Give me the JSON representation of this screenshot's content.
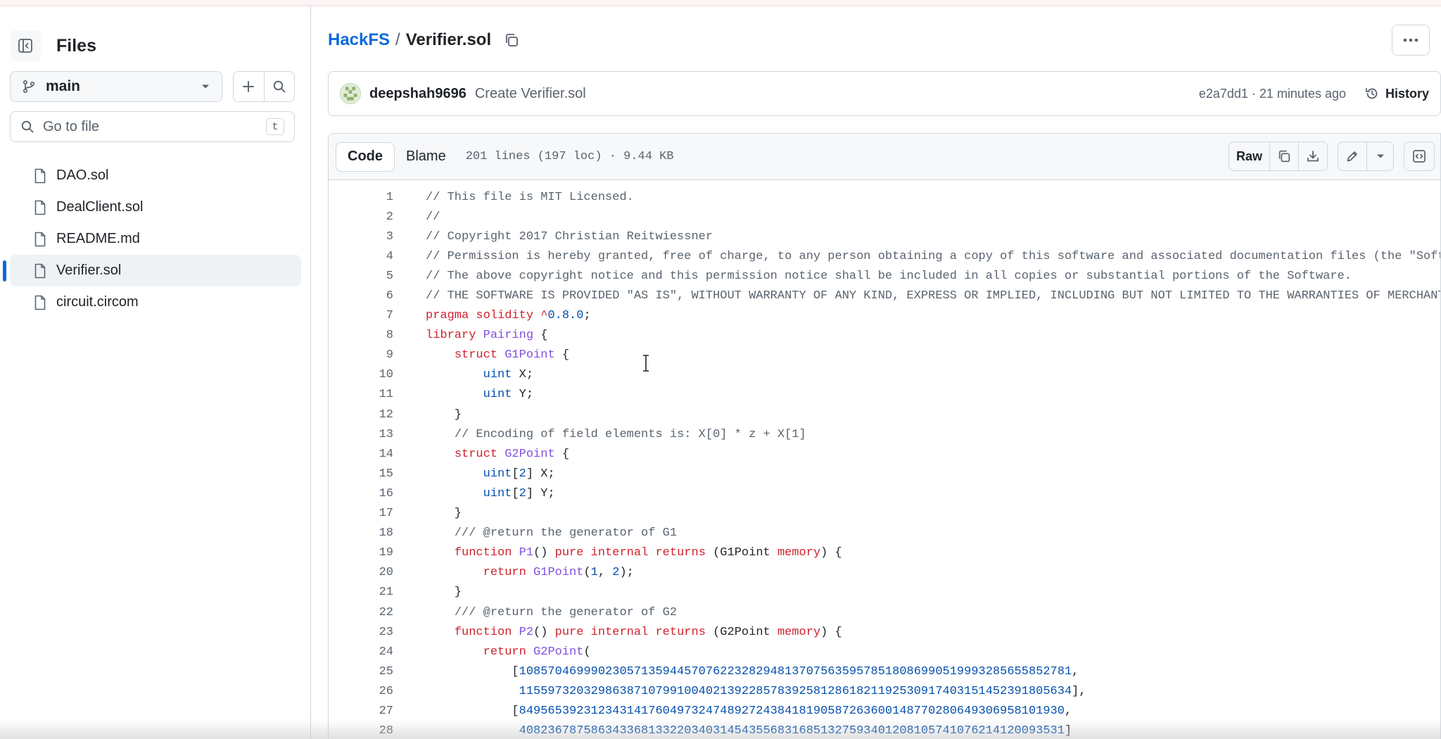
{
  "sidebar": {
    "title": "Files",
    "branch": "main",
    "goto_placeholder": "Go to file",
    "goto_shortcut": "t",
    "files": [
      {
        "name": "DAO.sol",
        "active": false
      },
      {
        "name": "DealClient.sol",
        "active": false
      },
      {
        "name": "README.md",
        "active": false
      },
      {
        "name": "Verifier.sol",
        "active": true
      },
      {
        "name": "circuit.circom",
        "active": false
      }
    ]
  },
  "breadcrumb": {
    "repo": "HackFS",
    "separator": "/",
    "file": "Verifier.sol"
  },
  "commit": {
    "author": "deepshah9696",
    "message": "Create Verifier.sol",
    "meta": "e2a7dd1 · 21 minutes ago",
    "history_label": "History"
  },
  "file_header": {
    "tab_code": "Code",
    "tab_blame": "Blame",
    "info": "201 lines (197 loc) · 9.44 KB",
    "raw_label": "Raw"
  },
  "colors": {
    "accent": "#0969da",
    "comment": "#59636e",
    "keyword": "#cf222e",
    "type": "#0550ae",
    "entity": "#8250df"
  },
  "code_lines": [
    {
      "n": "1",
      "tokens": [
        [
          "c",
          "// This file is MIT Licensed."
        ]
      ]
    },
    {
      "n": "2",
      "tokens": [
        [
          "c",
          "//"
        ]
      ]
    },
    {
      "n": "3",
      "tokens": [
        [
          "c",
          "// Copyright 2017 Christian Reitwiessner"
        ]
      ]
    },
    {
      "n": "4",
      "tokens": [
        [
          "c",
          "// Permission is hereby granted, free of charge, to any person obtaining a copy of this software and associated documentation files (the \"Soft"
        ]
      ]
    },
    {
      "n": "5",
      "tokens": [
        [
          "c",
          "// The above copyright notice and this permission notice shall be included in all copies or substantial portions of the Software."
        ]
      ]
    },
    {
      "n": "6",
      "tokens": [
        [
          "c",
          "// THE SOFTWARE IS PROVIDED \"AS IS\", WITHOUT WARRANTY OF ANY KIND, EXPRESS OR IMPLIED, INCLUDING BUT NOT LIMITED TO THE WARRANTIES OF MERCHANT"
        ]
      ]
    },
    {
      "n": "7",
      "tokens": [
        [
          "k",
          "pragma solidity "
        ],
        [
          "k",
          "^"
        ],
        [
          "t",
          "0.8.0"
        ],
        [
          "p",
          ";"
        ]
      ]
    },
    {
      "n": "8",
      "tokens": [
        [
          "k",
          "library "
        ],
        [
          "e",
          "Pairing"
        ],
        [
          "p",
          " {"
        ]
      ]
    },
    {
      "n": "9",
      "tokens": [
        [
          "p",
          "    "
        ],
        [
          "k",
          "struct "
        ],
        [
          "e",
          "G1Point"
        ],
        [
          "p",
          " {"
        ]
      ]
    },
    {
      "n": "10",
      "tokens": [
        [
          "p",
          "        "
        ],
        [
          "t",
          "uint"
        ],
        [
          "p",
          " X;"
        ]
      ]
    },
    {
      "n": "11",
      "tokens": [
        [
          "p",
          "        "
        ],
        [
          "t",
          "uint"
        ],
        [
          "p",
          " Y;"
        ]
      ]
    },
    {
      "n": "12",
      "tokens": [
        [
          "p",
          "    }"
        ]
      ]
    },
    {
      "n": "13",
      "tokens": [
        [
          "p",
          "    "
        ],
        [
          "c",
          "// Encoding of field elements is: X[0] * z + X[1]"
        ]
      ]
    },
    {
      "n": "14",
      "tokens": [
        [
          "p",
          "    "
        ],
        [
          "k",
          "struct "
        ],
        [
          "e",
          "G2Point"
        ],
        [
          "p",
          " {"
        ]
      ]
    },
    {
      "n": "15",
      "tokens": [
        [
          "p",
          "        "
        ],
        [
          "t",
          "uint"
        ],
        [
          "p",
          "["
        ],
        [
          "t",
          "2"
        ],
        [
          "p",
          "] X;"
        ]
      ]
    },
    {
      "n": "16",
      "tokens": [
        [
          "p",
          "        "
        ],
        [
          "t",
          "uint"
        ],
        [
          "p",
          "["
        ],
        [
          "t",
          "2"
        ],
        [
          "p",
          "] Y;"
        ]
      ]
    },
    {
      "n": "17",
      "tokens": [
        [
          "p",
          "    }"
        ]
      ]
    },
    {
      "n": "18",
      "tokens": [
        [
          "p",
          "    "
        ],
        [
          "c",
          "/// @return the generator of G1"
        ]
      ]
    },
    {
      "n": "19",
      "tokens": [
        [
          "p",
          "    "
        ],
        [
          "k",
          "function "
        ],
        [
          "e",
          "P1"
        ],
        [
          "p",
          "() "
        ],
        [
          "k",
          "pure internal returns"
        ],
        [
          "p",
          " (G1Point "
        ],
        [
          "k",
          "memory"
        ],
        [
          "p",
          ") {"
        ]
      ]
    },
    {
      "n": "20",
      "tokens": [
        [
          "p",
          "        "
        ],
        [
          "k",
          "return "
        ],
        [
          "e",
          "G1Point"
        ],
        [
          "p",
          "("
        ],
        [
          "t",
          "1"
        ],
        [
          "p",
          ", "
        ],
        [
          "t",
          "2"
        ],
        [
          "p",
          ");"
        ]
      ]
    },
    {
      "n": "21",
      "tokens": [
        [
          "p",
          "    }"
        ]
      ]
    },
    {
      "n": "22",
      "tokens": [
        [
          "p",
          "    "
        ],
        [
          "c",
          "/// @return the generator of G2"
        ]
      ]
    },
    {
      "n": "23",
      "tokens": [
        [
          "p",
          "    "
        ],
        [
          "k",
          "function "
        ],
        [
          "e",
          "P2"
        ],
        [
          "p",
          "() "
        ],
        [
          "k",
          "pure internal returns"
        ],
        [
          "p",
          " (G2Point "
        ],
        [
          "k",
          "memory"
        ],
        [
          "p",
          ") {"
        ]
      ]
    },
    {
      "n": "24",
      "tokens": [
        [
          "p",
          "        "
        ],
        [
          "k",
          "return "
        ],
        [
          "e",
          "G2Point"
        ],
        [
          "p",
          "("
        ]
      ]
    },
    {
      "n": "25",
      "tokens": [
        [
          "p",
          "            ["
        ],
        [
          "t",
          "10857046999023057135944570762232829481370756359578518086990519993285655852781"
        ],
        [
          "p",
          ","
        ]
      ]
    },
    {
      "n": "26",
      "tokens": [
        [
          "p",
          "             "
        ],
        [
          "t",
          "11559732032986387107991004021392285783925812861821192530917403151452391805634"
        ],
        [
          "p",
          "],"
        ]
      ]
    },
    {
      "n": "27",
      "tokens": [
        [
          "p",
          "            ["
        ],
        [
          "t",
          "8495653923123431417604973247489272438418190587263600148770280649306958101930"
        ],
        [
          "p",
          ","
        ]
      ]
    },
    {
      "n": "28",
      "tokens": [
        [
          "p",
          "             "
        ],
        [
          "t",
          "4082367875863433681332203403145435568316851327593401208105741076214120093531"
        ],
        [
          "p",
          "]"
        ]
      ]
    }
  ]
}
